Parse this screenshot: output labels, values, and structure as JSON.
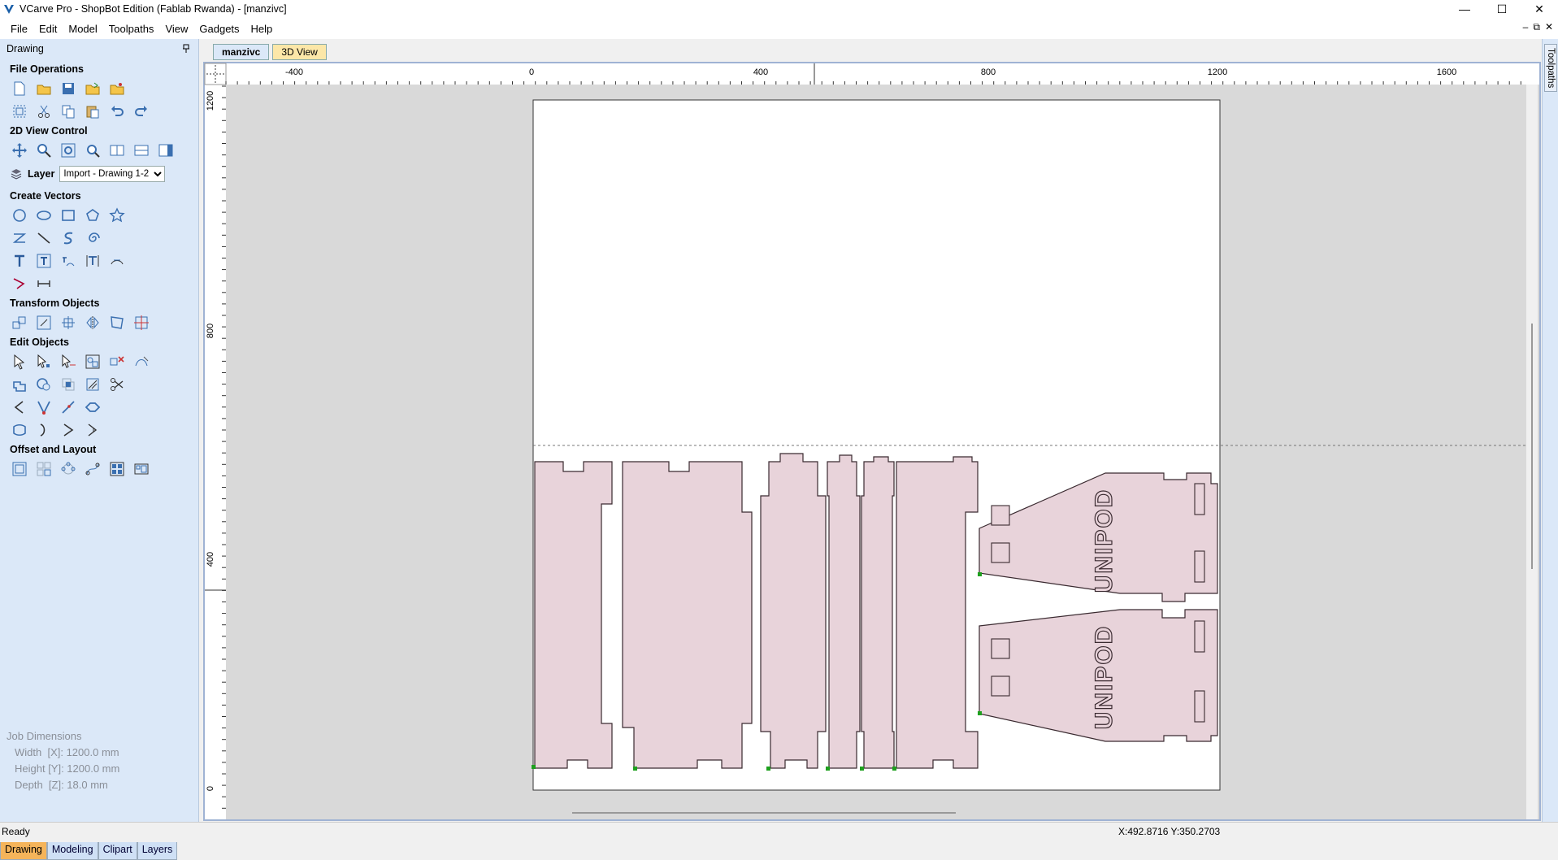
{
  "window": {
    "title": "VCarve Pro - ShopBot Edition (Fablab Rwanda) - [manzivc]",
    "controls": {
      "minimize": "—",
      "maximize": "☐",
      "close": "✕"
    }
  },
  "menu": {
    "items": [
      "File",
      "Edit",
      "Model",
      "Toolpaths",
      "View",
      "Gadgets",
      "Help"
    ],
    "mdi_controls": [
      "–",
      "⧉",
      "✕"
    ]
  },
  "left_panel": {
    "title": "Drawing",
    "pin_icon": "pin-icon",
    "sections": {
      "file_operations": "File Operations",
      "view_control": "2D View Control",
      "create_vectors": "Create Vectors",
      "transform": "Transform Objects",
      "edit_objects": "Edit Objects",
      "offset_layout": "Offset and Layout"
    },
    "layer": {
      "label": "Layer",
      "selected": "Import - Drawing 1-2"
    },
    "job_dimensions": {
      "heading": "Job Dimensions",
      "width": "Width  [X]: 1200.0 mm",
      "height": "Height [Y]: 1200.0 mm",
      "depth": "Depth  [Z]: 18.0 mm"
    },
    "bottom_tabs": [
      "Drawing",
      "Modeling",
      "Clipart",
      "Layers"
    ]
  },
  "document_tabs": [
    "manzivc",
    "3D View"
  ],
  "right_strip": {
    "label": "Toolpaths"
  },
  "rulers": {
    "horizontal_ticks": [
      "-400",
      "0",
      "400",
      "800",
      "1200",
      "1600"
    ],
    "vertical_ticks": [
      "1200",
      "800",
      "400",
      "0"
    ]
  },
  "canvas": {
    "text_labels": [
      "UNIPOD",
      "UNIPOD"
    ],
    "colors": {
      "background": "#d9d9d9",
      "sheet": "#ffffff",
      "vector": "#3a2a30",
      "highlight": "#e6c9d2",
      "node": "#1ea01e"
    }
  },
  "status": {
    "text": "Ready",
    "coords": "X:492.8716 Y:350.2703"
  }
}
